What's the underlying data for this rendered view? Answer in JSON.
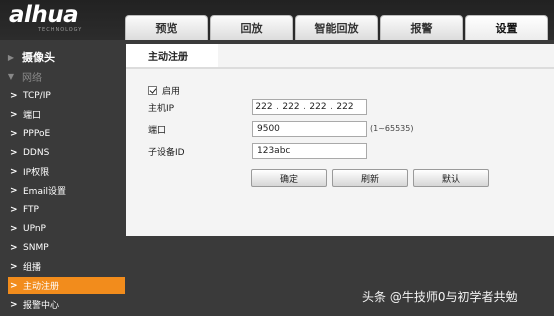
{
  "brand": {
    "logo_text": "alhua",
    "logo_sub": "TECHNOLOGY"
  },
  "tabs": [
    {
      "label": "预览"
    },
    {
      "label": "回放"
    },
    {
      "label": "智能回放"
    },
    {
      "label": "报警"
    },
    {
      "label": "设置"
    }
  ],
  "sidebar": {
    "camera": "摄像头",
    "network": "网络",
    "items": [
      {
        "label": "TCP/IP"
      },
      {
        "label": "端口"
      },
      {
        "label": "PPPoE"
      },
      {
        "label": "DDNS"
      },
      {
        "label": "IP权限"
      },
      {
        "label": "Email设置"
      },
      {
        "label": "FTP"
      },
      {
        "label": "UPnP"
      },
      {
        "label": "SNMP"
      },
      {
        "label": "组播"
      },
      {
        "label": "主动注册"
      },
      {
        "label": "报警中心"
      }
    ]
  },
  "panel": {
    "tab": "主动注册",
    "enable_label": "启用",
    "enable_checked": true,
    "host_ip_label": "主机IP",
    "host_ip": [
      "222",
      "222",
      "222",
      "222"
    ],
    "port_label": "端口",
    "port_value": "9500",
    "port_hint": "(1~65535)",
    "device_id_label": "子设备ID",
    "device_id_value": "123abc",
    "buttons": {
      "ok": "确定",
      "refresh": "刷新",
      "default": "默认"
    }
  },
  "watermark": "头条 @牛技师0与初学者共勉"
}
